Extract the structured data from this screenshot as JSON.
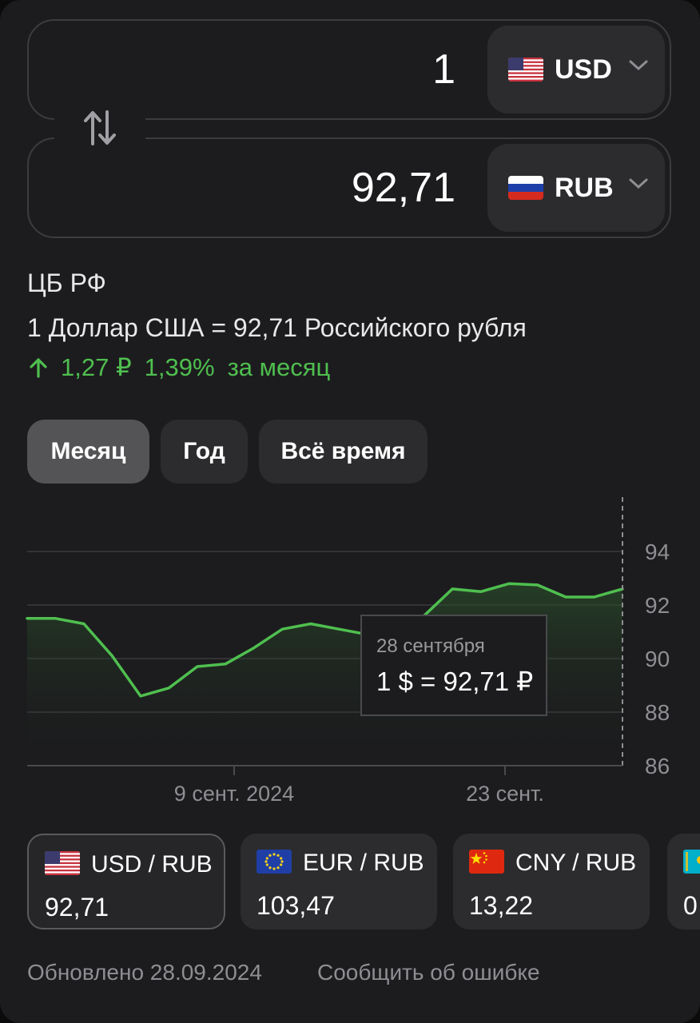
{
  "converter": {
    "from": {
      "amount": "1",
      "currency": "USD"
    },
    "to": {
      "amount": "92,71",
      "currency": "RUB"
    }
  },
  "rate_info": {
    "source": "ЦБ РФ",
    "description": "1 Доллар США = 92,71 Российского рубля",
    "change_abs": "1,27 ₽",
    "change_pct": "1,39%",
    "change_period": "за месяц",
    "direction": "up"
  },
  "periods": [
    {
      "label": "Месяц",
      "active": true
    },
    {
      "label": "Год",
      "active": false
    },
    {
      "label": "Всё время",
      "active": false
    }
  ],
  "chart_data": {
    "type": "area",
    "series": [
      {
        "values": [
          91.5,
          91.5,
          91.3,
          90.1,
          88.6,
          88.9,
          89.7,
          89.8,
          90.4,
          91.1,
          91.3,
          91.1,
          90.9,
          91.2,
          91.6,
          92.6,
          92.5,
          92.8,
          92.75,
          92.3,
          92.3,
          92.6
        ]
      }
    ],
    "yticks": [
      "94",
      "92",
      "90",
      "88",
      "86"
    ],
    "ylim": [
      86,
      94
    ],
    "x_tick_labels": [
      "9 сент. 2024",
      "23 сент."
    ],
    "color": "#4fbf4f"
  },
  "tooltip": {
    "date": "28 сентября",
    "value": "1 $ = 92,71 ₽"
  },
  "pairs": [
    {
      "name": "USD / RUB",
      "value": "92,71",
      "flag": "us",
      "active": true
    },
    {
      "name": "EUR / RUB",
      "value": "103,47",
      "flag": "eu",
      "active": false
    },
    {
      "name": "CNY / RUB",
      "value": "13,22",
      "flag": "cn",
      "active": false
    },
    {
      "name": "",
      "value": "0",
      "flag": "kz",
      "active": false
    }
  ],
  "footer": {
    "updated": "Обновлено 28.09.2024",
    "report": "Сообщить об ошибке"
  }
}
